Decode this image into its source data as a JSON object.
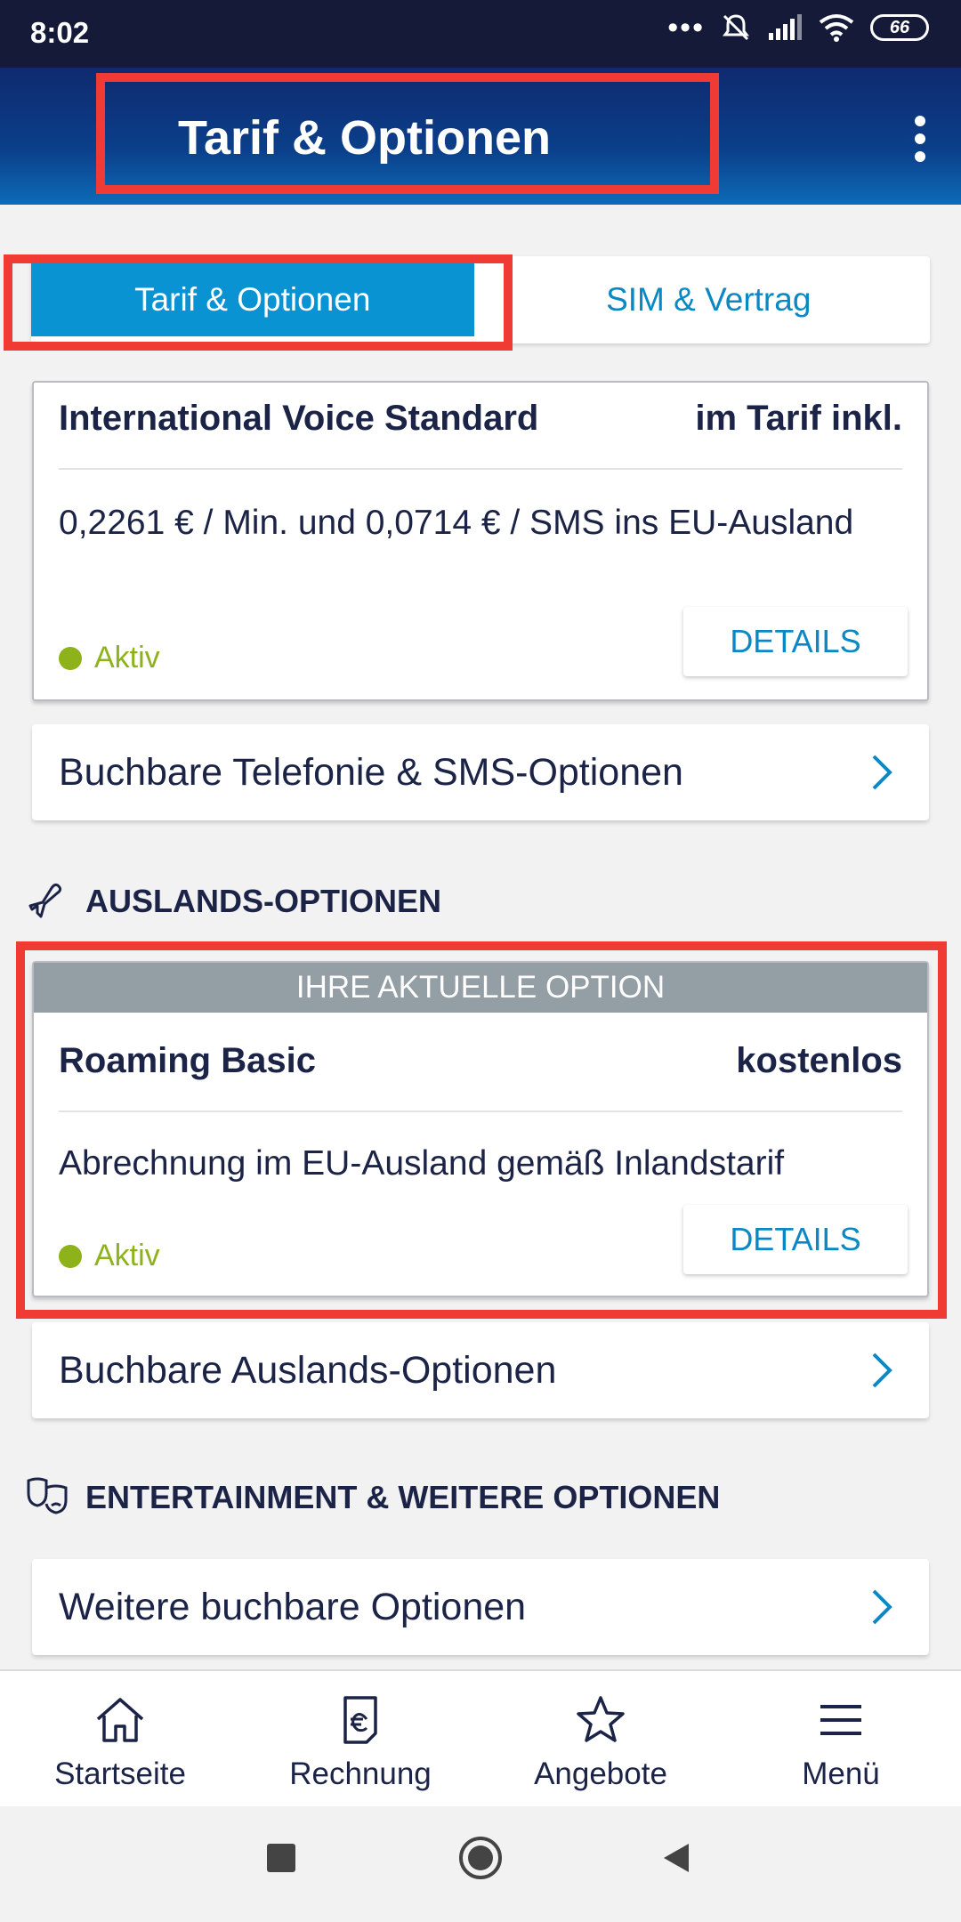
{
  "status_bar": {
    "time": "8:02",
    "more_dots": "•••",
    "battery": "66"
  },
  "header": {
    "title": "Tarif & Optionen"
  },
  "tabs": [
    {
      "label": "Tarif & Optionen",
      "active": true
    },
    {
      "label": "SIM & Vertrag",
      "active": false
    }
  ],
  "voice_option": {
    "title": "International Voice Standard",
    "price": "im Tarif inkl.",
    "description": "0,2261 € / Min. und 0,0714 € / SMS ins EU-Ausland",
    "status": "Aktiv",
    "details_label": "DETAILS"
  },
  "telephony_link": {
    "label": "Buchbare Telefonie & SMS-Optionen"
  },
  "abroad_section": {
    "title": "AUSLANDS-OPTIONEN"
  },
  "roaming_option": {
    "banner": "IHRE AKTUELLE OPTION",
    "title": "Roaming Basic",
    "price": "kostenlos",
    "description": "Abrechnung im EU-Ausland gemäß Inlandstarif",
    "status": "Aktiv",
    "details_label": "DETAILS"
  },
  "abroad_link": {
    "label": "Buchbare Auslands-Optionen"
  },
  "entertainment_section": {
    "title": "ENTERTAINMENT & WEITERE OPTIONEN"
  },
  "more_link": {
    "label": "Weitere buchbare Optionen"
  },
  "bottom_nav": [
    {
      "label": "Startseite",
      "icon": "home-icon"
    },
    {
      "label": "Rechnung",
      "icon": "invoice-euro-icon"
    },
    {
      "label": "Angebote",
      "icon": "star-icon"
    },
    {
      "label": "Menü",
      "icon": "hamburger-menu-icon"
    }
  ],
  "colors": {
    "accent": "#0993d2",
    "link": "#0a88c4",
    "active_green": "#8db21a",
    "highlight_red": "#ef3b33",
    "text_dark": "#1b2347"
  }
}
